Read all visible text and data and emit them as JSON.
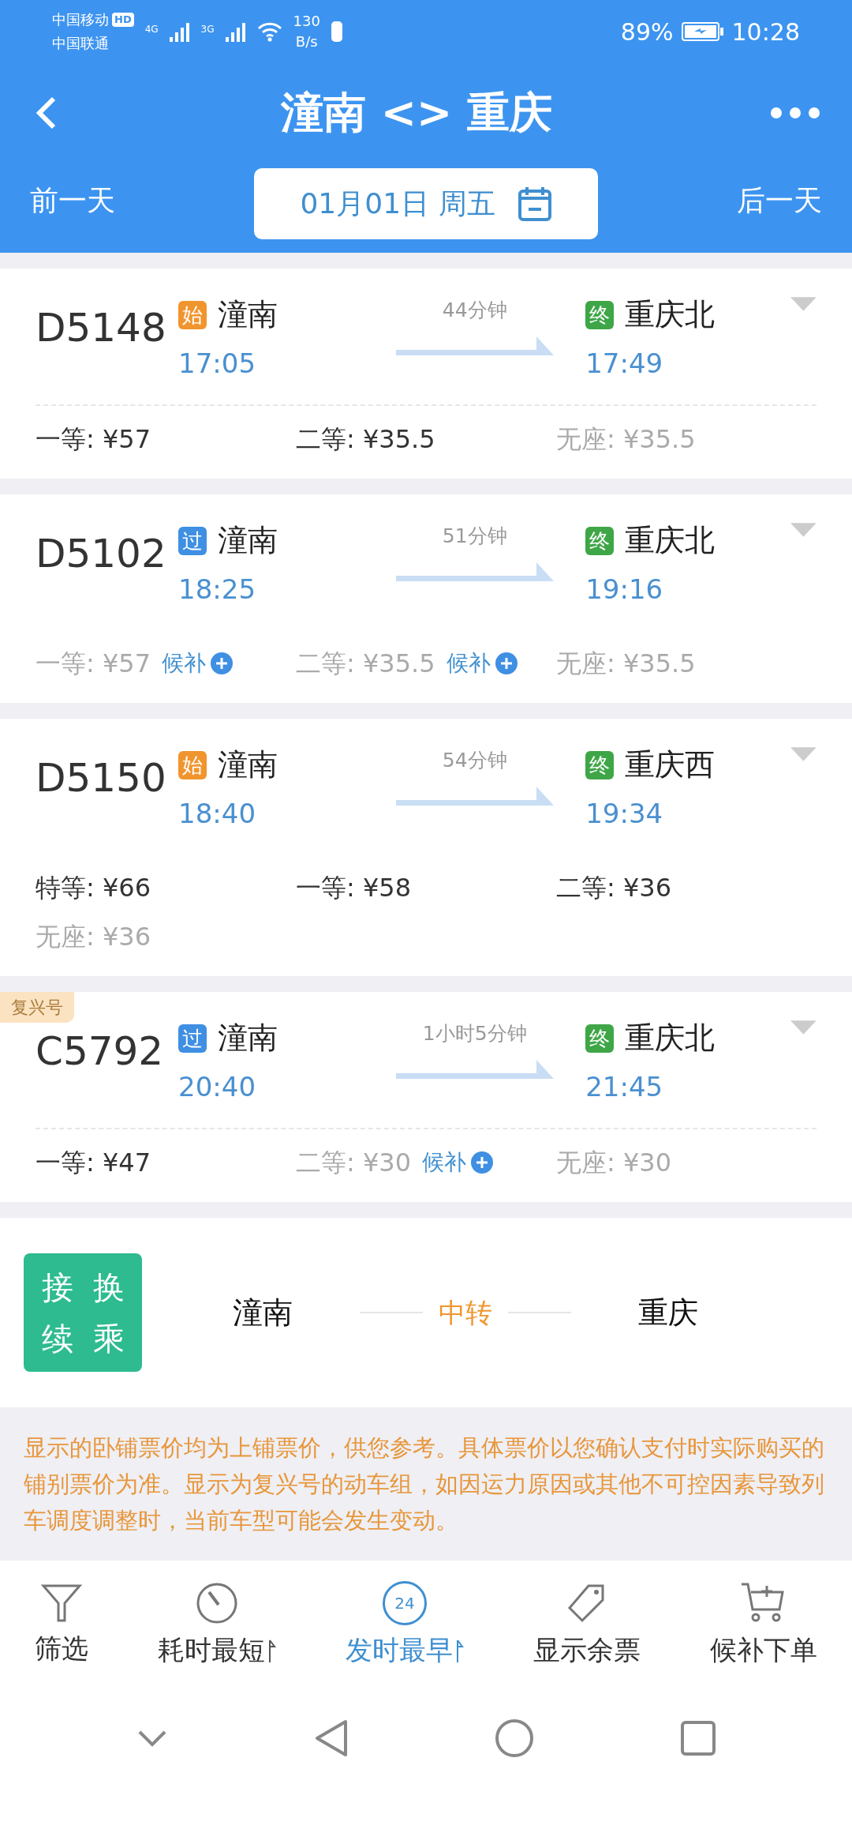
{
  "status_bar": {
    "carrier_1": "中国移动",
    "hd": "HD",
    "carrier_2": "中国联通",
    "net_1": "4G",
    "net_2": "3G",
    "speed": "130",
    "speed_unit": "B/s",
    "battery": "89%",
    "time": "10:28"
  },
  "header": {
    "title": "潼南 <> 重庆",
    "prev_day": "前一天",
    "date": "01月01日 周五",
    "next_day": "后一天"
  },
  "trains": [
    {
      "number": "D5148",
      "from_badge": {
        "kind": "start",
        "label": "始"
      },
      "from": "潼南",
      "depart": "17:05",
      "duration": "44分钟",
      "to_badge": {
        "kind": "end",
        "label": "终"
      },
      "to": "重庆北",
      "arrive": "17:49",
      "divider": true,
      "seats": [
        {
          "label": "一等: ¥57",
          "available": true
        },
        {
          "label": "二等: ¥35.5",
          "available": true
        },
        {
          "label": "无座: ¥35.5",
          "available": false
        }
      ]
    },
    {
      "number": "D5102",
      "from_badge": {
        "kind": "pass",
        "label": "过"
      },
      "from": "潼南",
      "depart": "18:25",
      "duration": "51分钟",
      "to_badge": {
        "kind": "end",
        "label": "终"
      },
      "to": "重庆北",
      "arrive": "19:16",
      "divider": false,
      "seats": [
        {
          "label": "一等: ¥57",
          "available": false,
          "waitlist": "候补"
        },
        {
          "label": "二等: ¥35.5",
          "available": false,
          "waitlist": "候补"
        },
        {
          "label": "无座: ¥35.5",
          "available": false
        }
      ]
    },
    {
      "number": "D5150",
      "from_badge": {
        "kind": "start",
        "label": "始"
      },
      "from": "潼南",
      "depart": "18:40",
      "duration": "54分钟",
      "to_badge": {
        "kind": "end",
        "label": "终"
      },
      "to": "重庆西",
      "arrive": "19:34",
      "divider": false,
      "seats": [
        {
          "label": "特等: ¥66",
          "available": true
        },
        {
          "label": "一等: ¥58",
          "available": true
        },
        {
          "label": "二等: ¥36",
          "available": true
        },
        {
          "label": "无座: ¥36",
          "available": false
        }
      ]
    },
    {
      "number": "C5792",
      "tag": "复兴号",
      "from_badge": {
        "kind": "pass",
        "label": "过"
      },
      "from": "潼南",
      "depart": "20:40",
      "duration": "1小时5分钟",
      "to_badge": {
        "kind": "end",
        "label": "终"
      },
      "to": "重庆北",
      "arrive": "21:45",
      "divider": true,
      "seats": [
        {
          "label": "一等: ¥47",
          "available": true
        },
        {
          "label": "二等: ¥30",
          "available": false,
          "waitlist": "候补"
        },
        {
          "label": "无座: ¥30",
          "available": false
        }
      ]
    }
  ],
  "transfer": {
    "badge": [
      "接",
      "换",
      "续",
      "乘"
    ],
    "from": "潼南",
    "via": "中转",
    "to": "重庆"
  },
  "notice": "显示的卧铺票价均为上铺票价，供您参考。具体票价以您确认支付时实际购买的铺别票价为准。显示为复兴号的动车组，如因运力原因或其他不可控因素导致列车调度调整时，当前车型可能会发生变动。",
  "toolbar": [
    {
      "kind": "filter",
      "label": "筛选",
      "selected": false,
      "sort": false
    },
    {
      "kind": "duration",
      "label": "耗时最短",
      "selected": false,
      "sort": true
    },
    {
      "kind": "depart",
      "label": "发时最早",
      "selected": true,
      "sort": true,
      "icon_text": "24"
    },
    {
      "kind": "tickets",
      "label": "显示余票",
      "selected": false,
      "sort": false
    },
    {
      "kind": "waitlist",
      "label": "候补下单",
      "selected": false,
      "sort": false
    }
  ]
}
